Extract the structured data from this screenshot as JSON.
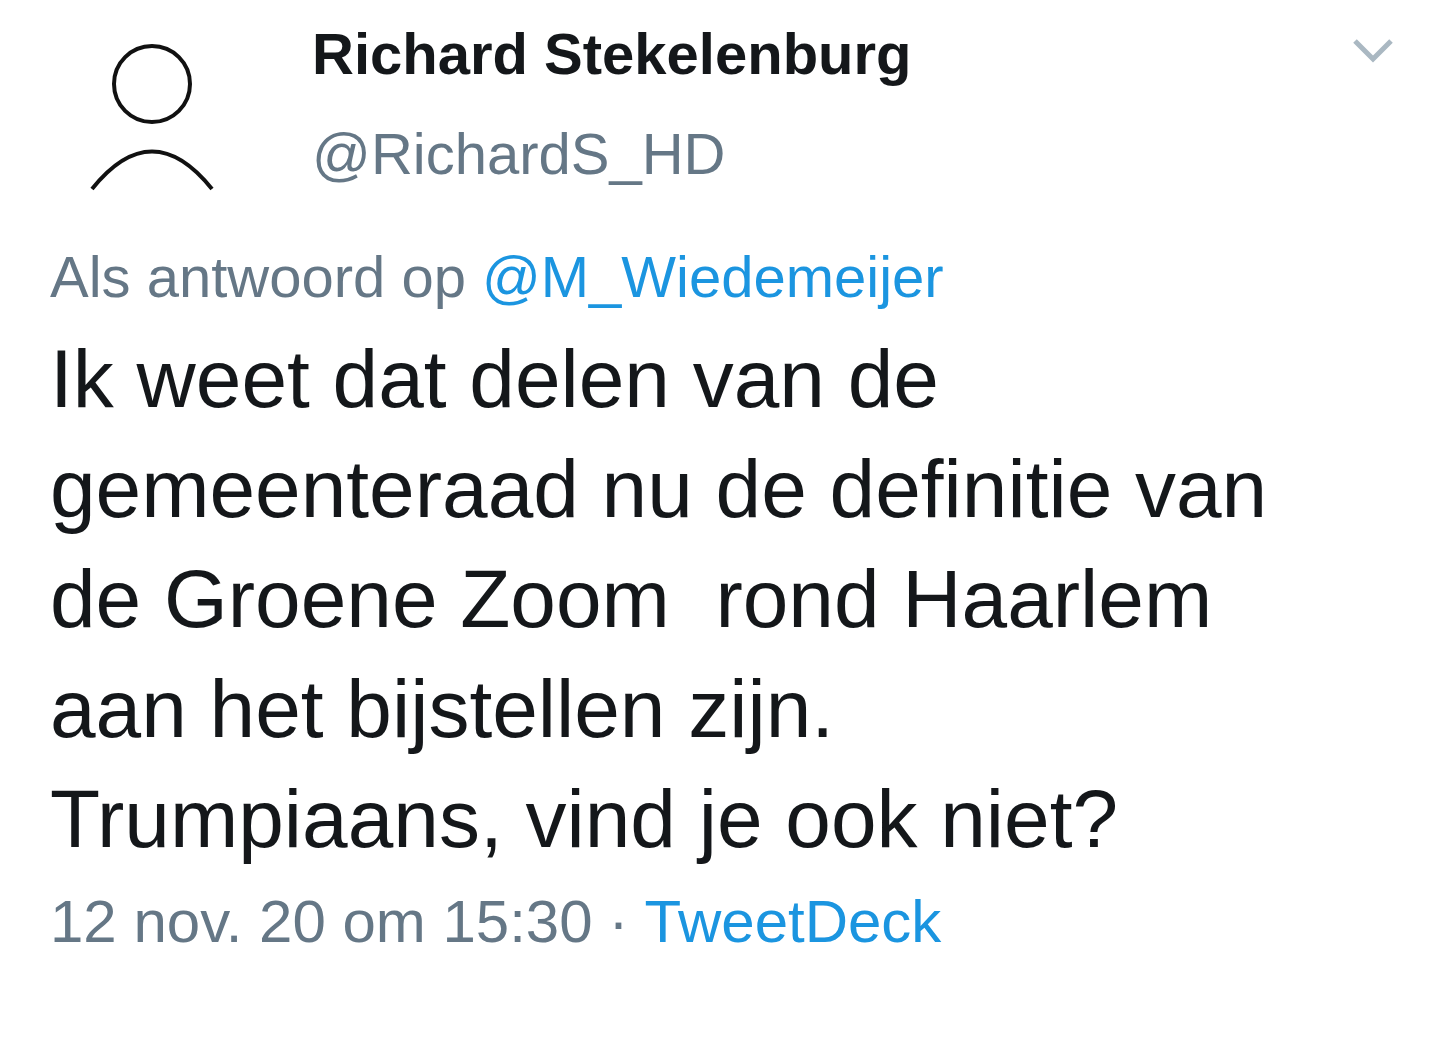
{
  "author": {
    "name": "Richard Stekelenburg",
    "handle": "@RichardS_HD"
  },
  "reply_to": {
    "prefix": "Als antwoord op",
    "mention": "@M_Wiedemeijer"
  },
  "text": "Ik weet dat delen van de gemeenteraad nu de definitie van de Groene Zoom  rond Haarlem aan het bijstellen zijn. Trumpiaans, vind je ook niet?",
  "meta": {
    "timestamp": "12 nov. 20 om 15:30",
    "separator": "·",
    "source": "TweetDeck"
  }
}
